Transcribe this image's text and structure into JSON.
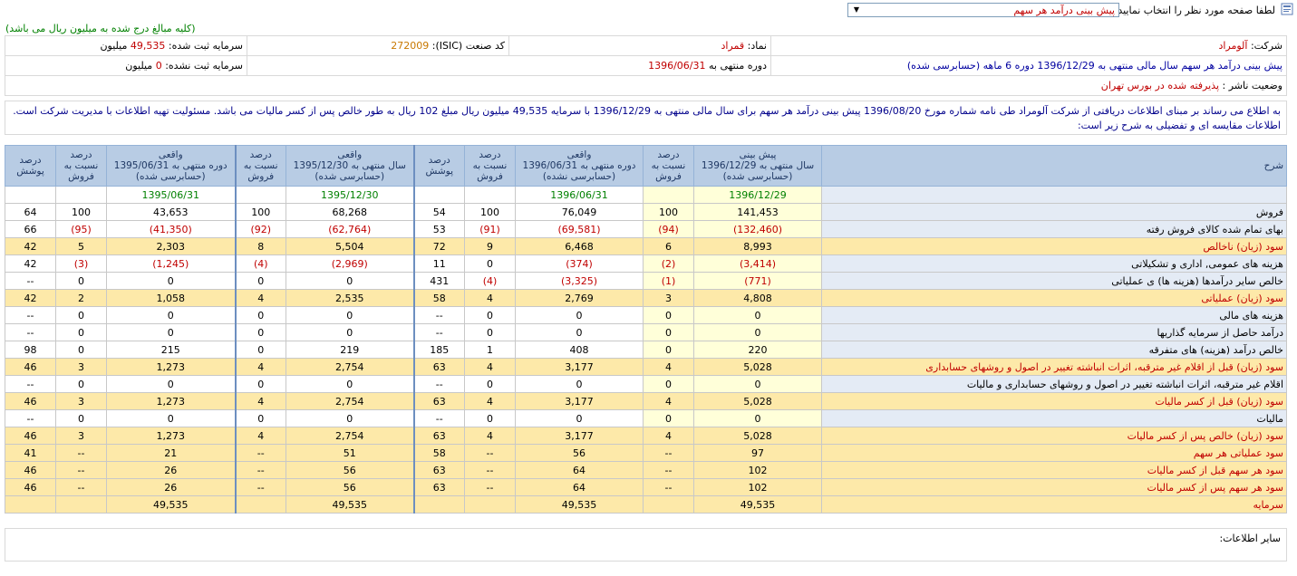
{
  "header": {
    "prompt": "لطفا صفحه مورد نظر را انتخاب نمایید :",
    "selected": "پیش بینی درآمد هر سهم",
    "arrow": "▼"
  },
  "note": "(کلیه مبالغ درج شده به میلیون ریال می باشد)",
  "info": {
    "company_label": "شرکت:",
    "company_value": "آلومراد",
    "symbol_label": "نماد:",
    "symbol_value": "قمراد",
    "isic_label": "کد صنعت (ISIC):",
    "isic_value": "272009",
    "reg_label": "سرمایه ثبت شده:",
    "reg_value": "49,535",
    "reg_unit": "میلیون",
    "forecast_text": "پیش بینی درآمد هر سهم سال مالی منتهی به 1396/12/29 دوره 6 ماهه",
    "forecast_status": "(حسابرسی شده)",
    "period_label": "دوره منتهی به",
    "period_value": "1396/06/31",
    "unreg_label": "سرمایه ثبت نشده:",
    "unreg_value": "0",
    "unreg_unit": "میلیون",
    "publisher_label": "وضعیت ناشر :",
    "publisher_value": "پذیرفته شده در بورس تهران"
  },
  "description": "به اطلاع می رساند بر مبنای اطلاعات دریافتی از شرکت آلومراد طی نامه شماره مورخ 1396/08/20 پیش بینی درآمد هر سهم برای سال مالی منتهی به 1396/12/29 با سرمایه 49,535 میلیون ریال مبلغ 102 ریال به طور خالص پس از کسر مالیات می باشد. مسئولیت تهیه اطلاعات با مدیریت شرکت است. اطلاعات مقایسه ای و تفضیلی به شرح زیر است:",
  "table": {
    "headers": {
      "sharh": "شرح",
      "g1": [
        "پیش بینی",
        "سال منتهی به 1396/12/29",
        "(حسابرسی شده)"
      ],
      "pct_sales": [
        "درصد",
        "نسبت به",
        "فروش"
      ],
      "g2": [
        "واقعی",
        "دوره منتهی به 1396/06/31",
        "(حسابرسی نشده)"
      ],
      "pct_cover": [
        "درصد",
        "پوشش"
      ],
      "g3": [
        "واقعی",
        "سال منتهی به 1395/12/30",
        "(حسابرسی شده)"
      ],
      "g4": [
        "واقعی",
        "دوره منتهی به 1395/06/31",
        "(حسابرسی شده)"
      ]
    },
    "dates": [
      "1396/12/29",
      "1396/06/31",
      "1395/12/30",
      "1395/06/31"
    ],
    "rows": [
      {
        "label": "فروش",
        "hl": false,
        "v": [
          "141,453",
          "100",
          "76,049",
          "100",
          "54",
          "68,268",
          "100",
          "43,653",
          "100",
          "64"
        ]
      },
      {
        "label": "بهای تمام شده کالای فروش رفته",
        "hl": false,
        "v": [
          "(132,460)",
          "(94)",
          "(69,581)",
          "(91)",
          "53",
          "(62,764)",
          "(92)",
          "(41,350)",
          "(95)",
          "66"
        ]
      },
      {
        "label": "سود (زیان) ناخالص",
        "hl": true,
        "v": [
          "8,993",
          "6",
          "6,468",
          "9",
          "72",
          "5,504",
          "8",
          "2,303",
          "5",
          "42"
        ]
      },
      {
        "label": "هزینه های عمومی, اداری و تشکیلاتی",
        "hl": false,
        "v": [
          "(3,414)",
          "(2)",
          "(374)",
          "0",
          "11",
          "(2,969)",
          "(4)",
          "(1,245)",
          "(3)",
          "42"
        ]
      },
      {
        "label": "خالص سایر درآمدها (هزینه ها) ی عملیاتی",
        "hl": false,
        "v": [
          "(771)",
          "(1)",
          "(3,325)",
          "(4)",
          "431",
          "0",
          "0",
          "0",
          "0",
          "--"
        ]
      },
      {
        "label": "سود (زیان) عملیاتی",
        "hl": true,
        "v": [
          "4,808",
          "3",
          "2,769",
          "4",
          "58",
          "2,535",
          "4",
          "1,058",
          "2",
          "42"
        ]
      },
      {
        "label": "هزینه های مالی",
        "hl": false,
        "v": [
          "0",
          "0",
          "0",
          "0",
          "--",
          "0",
          "0",
          "0",
          "0",
          "--"
        ]
      },
      {
        "label": "درآمد حاصل از سرمایه گذاریها",
        "hl": false,
        "v": [
          "0",
          "0",
          "0",
          "0",
          "--",
          "0",
          "0",
          "0",
          "0",
          "--"
        ]
      },
      {
        "label": "خالص درآمد (هزینه) های متفرقه",
        "hl": false,
        "v": [
          "220",
          "0",
          "408",
          "1",
          "185",
          "219",
          "0",
          "215",
          "0",
          "98"
        ]
      },
      {
        "label": "سود (زیان) قبل از اقلام غیر مترقبه، اثرات انباشته تغییر در اصول و روشهای حسابداری",
        "hl": true,
        "v": [
          "5,028",
          "4",
          "3,177",
          "4",
          "63",
          "2,754",
          "4",
          "1,273",
          "3",
          "46"
        ]
      },
      {
        "label": "اقلام غیر مترقبه، اثرات انباشته تغییر در اصول و روشهای حسابداری و مالیات",
        "hl": false,
        "v": [
          "0",
          "0",
          "0",
          "0",
          "--",
          "0",
          "0",
          "0",
          "0",
          "--"
        ]
      },
      {
        "label": "سود (زیان) قبل از کسر مالیات",
        "hl": true,
        "v": [
          "5,028",
          "4",
          "3,177",
          "4",
          "63",
          "2,754",
          "4",
          "1,273",
          "3",
          "46"
        ]
      },
      {
        "label": "مالیات",
        "hl": false,
        "v": [
          "0",
          "0",
          "0",
          "0",
          "--",
          "0",
          "0",
          "0",
          "0",
          "--"
        ]
      },
      {
        "label": "سود (زیان) خالص پس از کسر مالیات",
        "hl": true,
        "v": [
          "5,028",
          "4",
          "3,177",
          "4",
          "63",
          "2,754",
          "4",
          "1,273",
          "3",
          "46"
        ]
      },
      {
        "label": "سود عملیاتی هر سهم",
        "hl": true,
        "v": [
          "97",
          "--",
          "56",
          "--",
          "58",
          "51",
          "--",
          "21",
          "--",
          "41"
        ]
      },
      {
        "label": "سود هر سهم قبل از کسر مالیات",
        "hl": true,
        "v": [
          "102",
          "--",
          "64",
          "--",
          "63",
          "56",
          "--",
          "26",
          "--",
          "46"
        ]
      },
      {
        "label": "سود هر سهم پس از کسر مالیات",
        "hl": true,
        "v": [
          "102",
          "--",
          "64",
          "--",
          "63",
          "56",
          "--",
          "26",
          "--",
          "46"
        ]
      },
      {
        "label": "سرمایه",
        "hl": true,
        "v": [
          "49,535",
          "",
          "49,535",
          "",
          "",
          "49,535",
          "",
          "49,535",
          "",
          ""
        ]
      }
    ]
  },
  "other_info": "سایر اطلاعات:"
}
